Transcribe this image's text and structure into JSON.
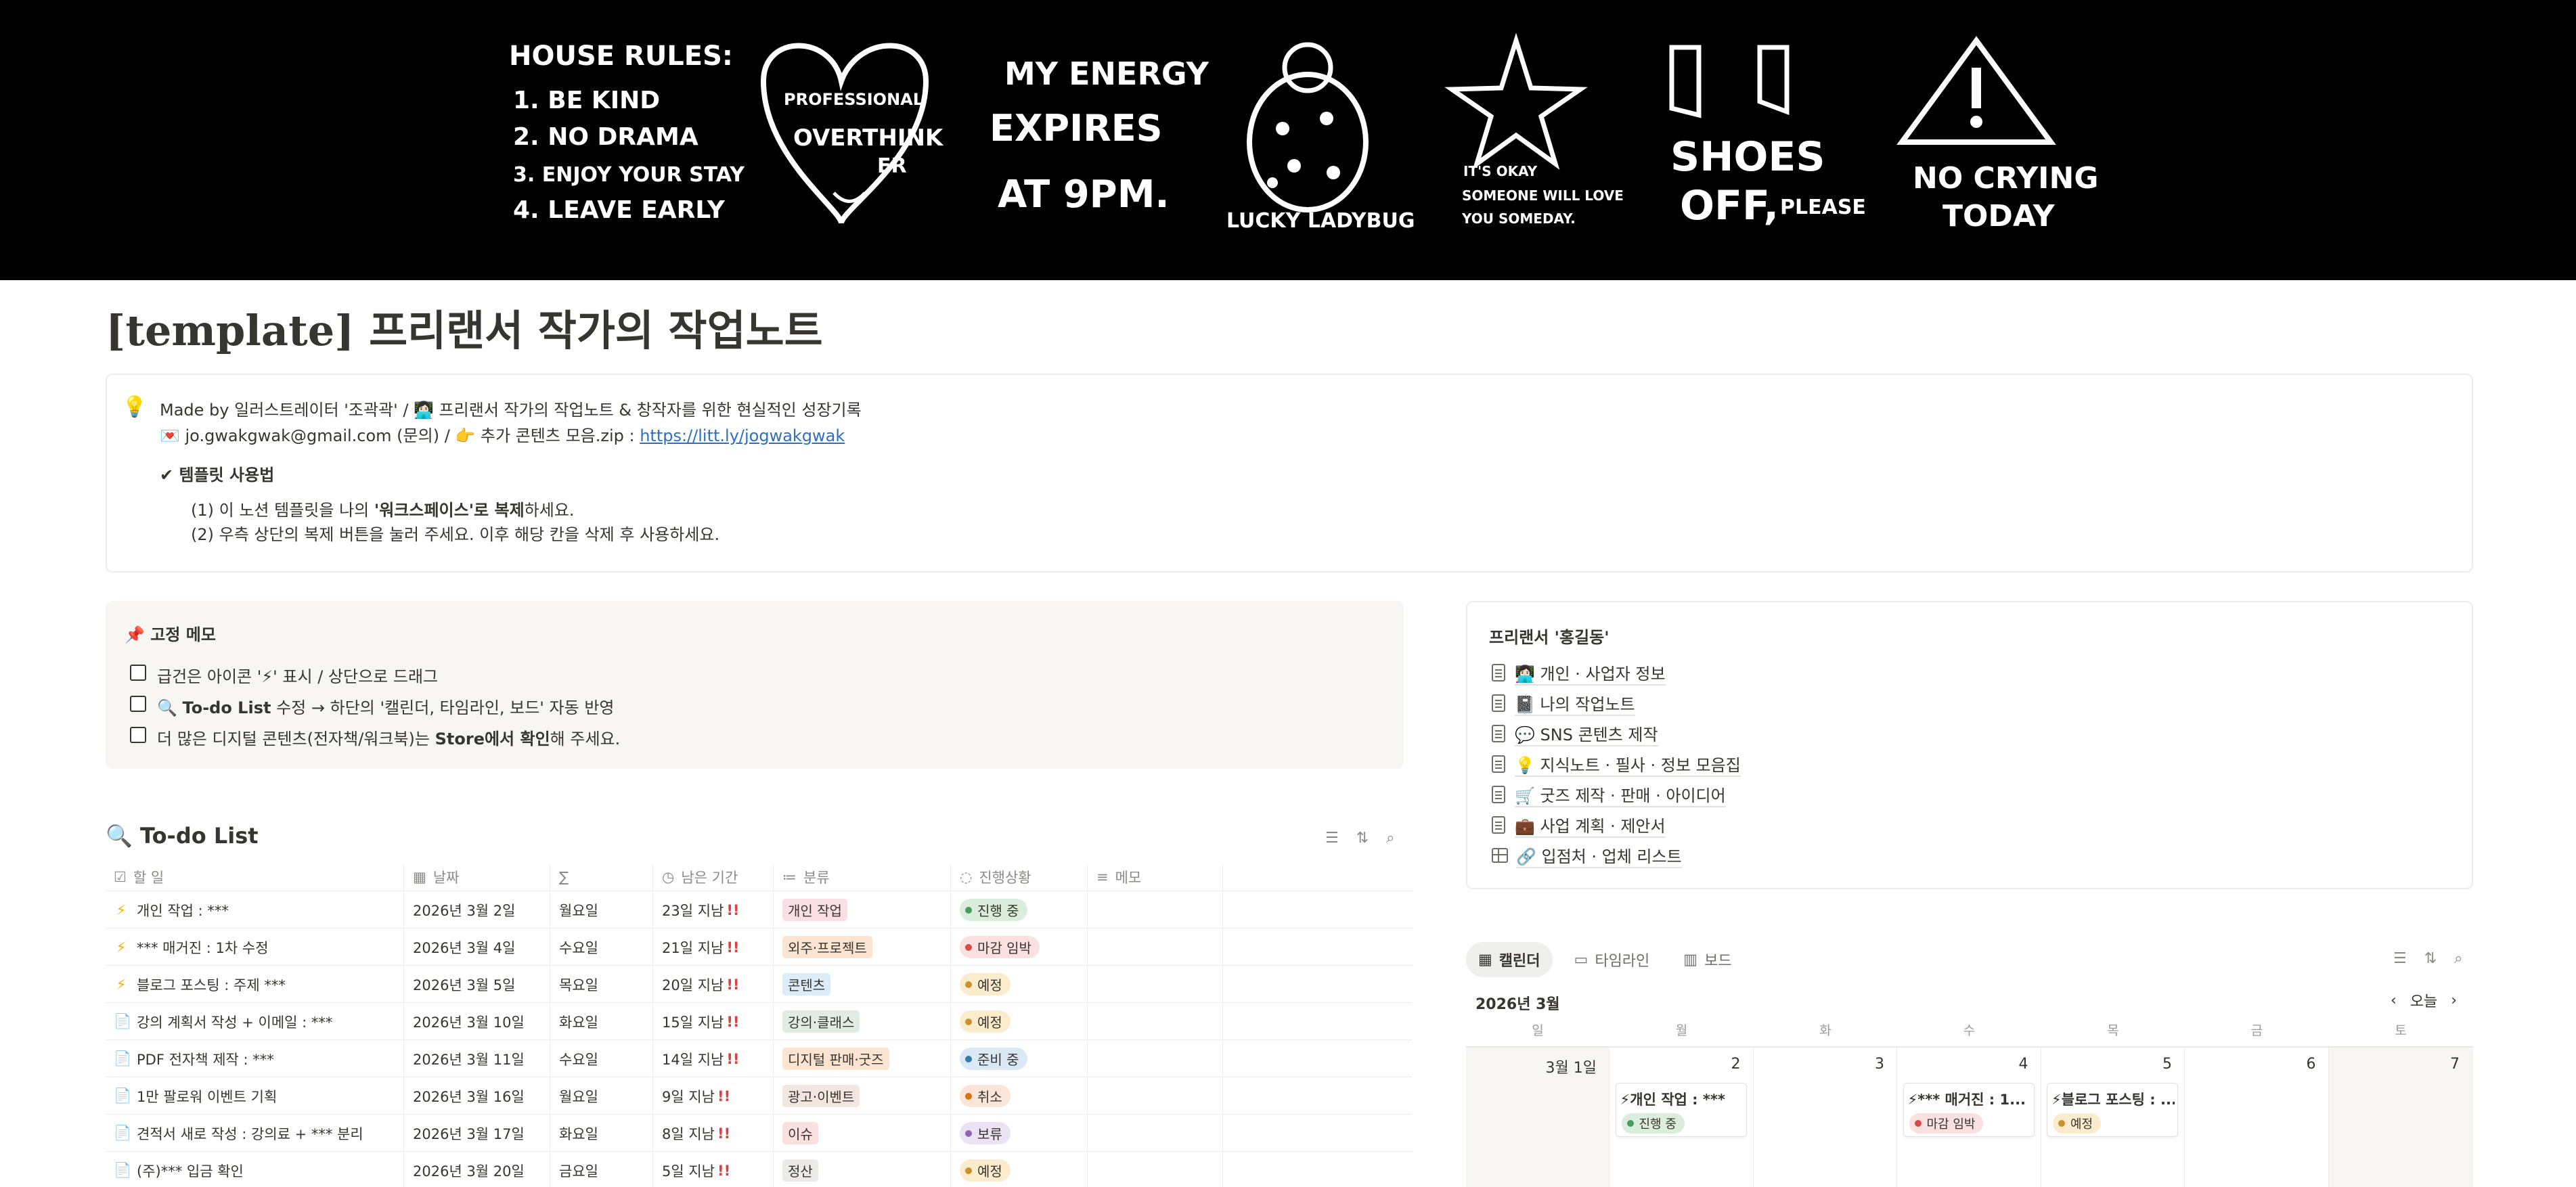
{
  "banner": {
    "house_rules": [
      "HOUSE RULES:",
      "1. BE KIND",
      "2. NO DRAMA",
      "3. ENJOY YOUR STAY",
      "4. LEAVE EARLY"
    ],
    "heart": [
      "PROFESSIONAL",
      "OVERTHINK",
      "ER"
    ],
    "energy": [
      "MY ENERGY",
      "EXPIRES",
      "AT 9PM."
    ],
    "ladybug": "LUCKY LADYBUG",
    "star": [
      "IT'S OKAY",
      "SOMEONE WILL LOVE",
      "YOU SOMEDAY."
    ],
    "shoes": [
      "SHOES",
      "OFF,",
      "PLEASE"
    ],
    "warning": [
      "NO CRYING",
      "TODAY"
    ]
  },
  "page": {
    "title": "[template] 프리랜서 작가의 작업노트"
  },
  "callout": {
    "icon": "💡",
    "line1": "Made by 일러스트레이터 '조곽곽' / 👩🏻‍💻 프리랜서 작가의 작업노트 & 창작자를 위한 현실적인 성장기록",
    "line2_prefix": "💌 jo.gwakgwak@gmail.com (문의) / 👉 추가 콘텐츠 모음.zip : ",
    "line2_link": "https://litt.ly/jogwakgwak",
    "usage_title": "✔ 템플릿 사용법",
    "step1_a": "(1) 이 노션 템플릿을 나의 ",
    "step1_b": "'워크스페이스'로 복제",
    "step1_c": "하세요.",
    "step2": "(2) 우측 상단의 복제 버튼을 눌러 주세요. 이후 해당 칸을 삭제 후 사용하세요."
  },
  "memo": {
    "title": "📌 고정 메모",
    "items": [
      {
        "a": "급건은 아이콘 '⚡' 표시 / 상단으로 드래그",
        "b": "",
        "c": ""
      },
      {
        "a": "🔍 ",
        "b": "To-do List",
        "c": " 수정 → 하단의 '캘린더, 타임라인, 보드' 자동 반영"
      },
      {
        "a": "더 많은 디지털 콘텐츠(전자책/워크북)는 ",
        "b": "Store에서 확인",
        "c": "해 주세요."
      }
    ]
  },
  "pages": {
    "title": "프리랜서 '홍길동'",
    "items": [
      {
        "label": "👩🏻‍💻 개인 · 사업자 정보",
        "icon": "doc-icon"
      },
      {
        "label": "📓 나의 작업노트",
        "icon": "doc-icon"
      },
      {
        "label": "💬 SNS 콘텐츠 제작",
        "icon": "doc-icon"
      },
      {
        "label": "💡 지식노트 · 필사 · 정보 모음집",
        "icon": "doc-icon"
      },
      {
        "label": "🛒 굿즈 제작 · 판매 · 아이디어",
        "icon": "doc-icon"
      },
      {
        "label": "💼 사업 계획 · 제안서",
        "icon": "doc-icon"
      },
      {
        "label": "🔗 입점처 · 업체 리스트",
        "icon": "table-icon"
      }
    ]
  },
  "todo": {
    "title": "🔍 To-do List",
    "headers": {
      "task": "할 일",
      "date": "날짜",
      "weekday": "∑",
      "remaining": "남은 기간",
      "category": "분류",
      "status": "진행상황",
      "memo": "메모"
    },
    "rows": [
      {
        "icon": "⚡",
        "task": "개인 작업 : ***",
        "date": "2026년 3월 2일",
        "weekday": "월요일",
        "remaining": "23일 지남",
        "category": "개인 작업",
        "status": "진행 중"
      },
      {
        "icon": "⚡",
        "task": "*** 매거진 : 1차 수정",
        "date": "2026년 3월 4일",
        "weekday": "수요일",
        "remaining": "21일 지남",
        "category": "외주·프로젝트",
        "status": "마감 임박"
      },
      {
        "icon": "⚡",
        "task": "블로그 포스팅 : 주제 ***",
        "date": "2026년 3월 5일",
        "weekday": "목요일",
        "remaining": "20일 지남",
        "category": "콘텐츠",
        "status": "예정"
      },
      {
        "icon": "📄",
        "task": "강의 계획서 작성 + 이메일 : ***",
        "date": "2026년 3월 10일",
        "weekday": "화요일",
        "remaining": "15일 지남",
        "category": "강의·클래스",
        "status": "예정"
      },
      {
        "icon": "📄",
        "task": "PDF 전자책 제작 : ***",
        "date": "2026년 3월 11일",
        "weekday": "수요일",
        "remaining": "14일 지남",
        "category": "디지털 판매·굿즈",
        "status": "준비 중"
      },
      {
        "icon": "📄",
        "task": "1만 팔로워 이벤트 기획",
        "date": "2026년 3월 16일",
        "weekday": "월요일",
        "remaining": "9일 지남",
        "category": "광고·이벤트",
        "status": "취소"
      },
      {
        "icon": "📄",
        "task": "견적서 새로 작성 : 강의료 + *** 분리",
        "date": "2026년 3월 17일",
        "weekday": "화요일",
        "remaining": "8일 지남",
        "category": "이슈",
        "status": "보류"
      },
      {
        "icon": "📄",
        "task": "(주)*** 입금 확인",
        "date": "2026년 3월 20일",
        "weekday": "금요일",
        "remaining": "5일 지남",
        "category": "정산",
        "status": "예정"
      }
    ],
    "bang": "!!"
  },
  "colors": {
    "categories": {
      "개인 작업": "#fadfe4",
      "외주·프로젝트": "#fbe4d2",
      "콘텐츠": "#dcecf9",
      "강의·클래스": "#e1ede2",
      "디지털 판매·굿즈": "#fbe4d2",
      "광고·이벤트": "#f3e6e0",
      "이슈": "#fbe0e0",
      "정산": "#ecebe8"
    },
    "statuses": {
      "진행 중": {
        "bg": "#dbeddd",
        "dot": "#4a9c5e"
      },
      "마감 임박": {
        "bg": "#fbe0e0",
        "dot": "#d44c47"
      },
      "예정": {
        "bg": "#fbeccd",
        "dot": "#cb912f"
      },
      "준비 중": {
        "bg": "#dbe9f7",
        "dot": "#337ea9"
      },
      "취소": {
        "bg": "#fbe4d8",
        "dot": "#d9730d"
      },
      "보류": {
        "bg": "#ebe3f4",
        "dot": "#9065b0"
      }
    }
  },
  "calendar": {
    "tabs": [
      {
        "label": "캘린더",
        "icon": "calendar-icon",
        "active": true
      },
      {
        "label": "타임라인",
        "icon": "timeline-icon",
        "active": false
      },
      {
        "label": "보드",
        "icon": "board-icon",
        "active": false
      }
    ],
    "month": "2026년 3월",
    "today": "오늘",
    "weekdays": [
      "일",
      "월",
      "화",
      "수",
      "목",
      "금",
      "토"
    ],
    "days": [
      {
        "label": "3월 1일",
        "weekend": true,
        "event": null
      },
      {
        "label": "2",
        "weekend": false,
        "event": {
          "title": "⚡개인 작업 : ***",
          "status": "진행 중"
        }
      },
      {
        "label": "3",
        "weekend": false,
        "event": null
      },
      {
        "label": "4",
        "weekend": false,
        "event": {
          "title": "⚡*** 매거진 : 1...",
          "status": "마감 임박"
        }
      },
      {
        "label": "5",
        "weekend": false,
        "event": {
          "title": "⚡블로그 포스팅 : ...",
          "status": "예정"
        }
      },
      {
        "label": "6",
        "weekend": false,
        "event": null
      },
      {
        "label": "7",
        "weekend": true,
        "event": null
      }
    ]
  }
}
